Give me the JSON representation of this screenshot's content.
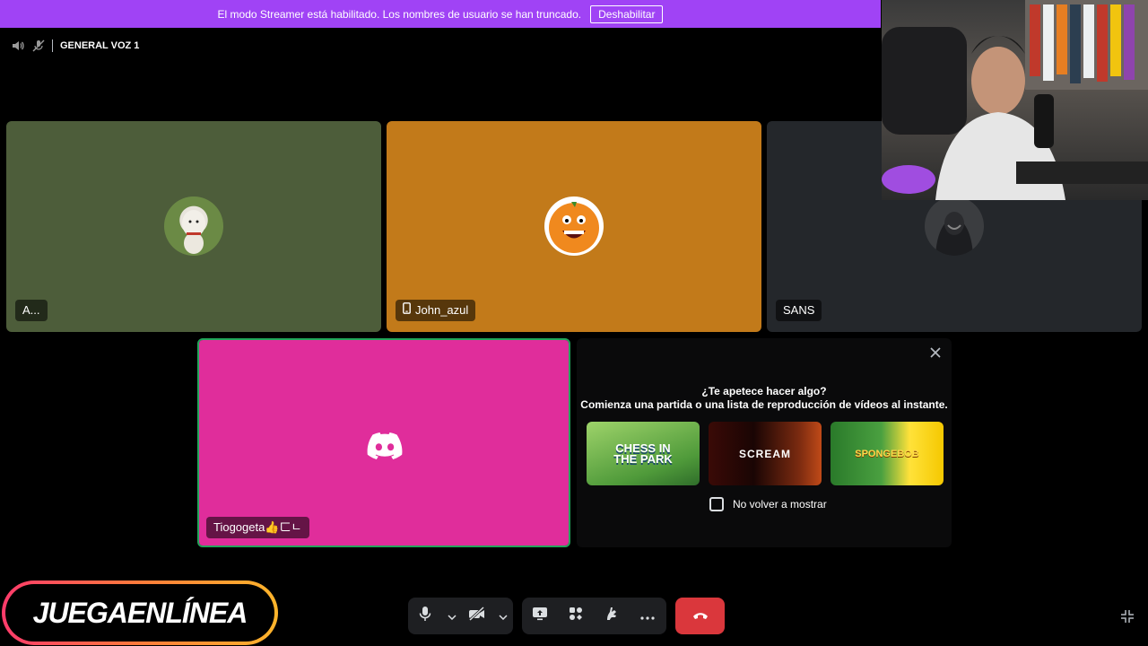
{
  "banner": {
    "text": "El modo Streamer está habilitado. Los nombres de usuario se han truncado.",
    "button": "Deshabilitar"
  },
  "channel": {
    "name": "GENERAL VOZ 1",
    "volume_icon": "speaker-icon",
    "mic_icon": "microphone-muted-icon"
  },
  "participants": [
    {
      "name": "A...",
      "tile_color": "#4d5d3a",
      "mobile": false
    },
    {
      "name": "John_azul",
      "tile_color": "#c27a1a",
      "mobile": true
    },
    {
      "name": "SANS",
      "tile_color": "#24272b",
      "mobile": false
    }
  ],
  "stream_tile": {
    "name": "Tiogogeta👍ㄈㄴ",
    "color": "#e02d9b",
    "icon": "discord-logo-icon"
  },
  "activity_panel": {
    "title": "¿Te apetece hacer algo?",
    "subtitle": "Comienza una partida o una lista de reproducción de vídeos al instante.",
    "games": [
      {
        "label": "CHESS IN THE PARK"
      },
      {
        "label": "SCREAM"
      },
      {
        "label": "SPONGEBOB"
      }
    ],
    "dont_show_again": "No volver a mostrar"
  },
  "logo_text": "JUEGAENLÍNEA",
  "colors": {
    "accent": "#a043f5",
    "hangup": "#da373c",
    "toolbar_bg": "#1e1f22",
    "selected_border": "#23a55a"
  }
}
